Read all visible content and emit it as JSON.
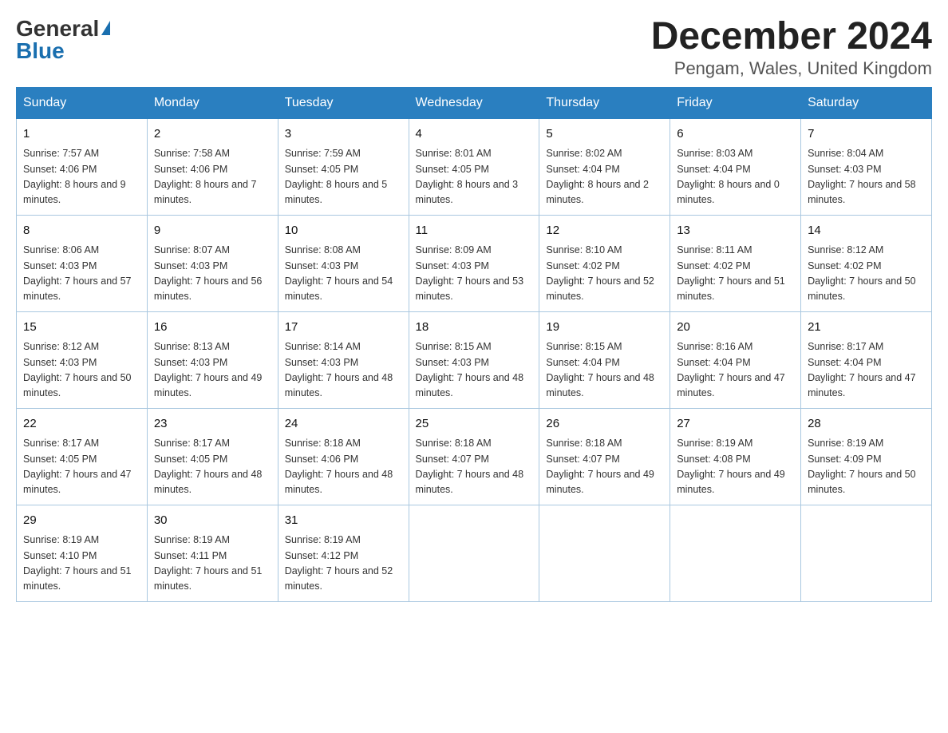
{
  "header": {
    "logo_general": "General",
    "logo_triangle": "▶",
    "logo_blue": "Blue",
    "month_title": "December 2024",
    "location": "Pengam, Wales, United Kingdom"
  },
  "days_of_week": [
    "Sunday",
    "Monday",
    "Tuesday",
    "Wednesday",
    "Thursday",
    "Friday",
    "Saturday"
  ],
  "weeks": [
    [
      {
        "day": "1",
        "sunrise": "7:57 AM",
        "sunset": "4:06 PM",
        "daylight": "8 hours and 9 minutes."
      },
      {
        "day": "2",
        "sunrise": "7:58 AM",
        "sunset": "4:06 PM",
        "daylight": "8 hours and 7 minutes."
      },
      {
        "day": "3",
        "sunrise": "7:59 AM",
        "sunset": "4:05 PM",
        "daylight": "8 hours and 5 minutes."
      },
      {
        "day": "4",
        "sunrise": "8:01 AM",
        "sunset": "4:05 PM",
        "daylight": "8 hours and 3 minutes."
      },
      {
        "day": "5",
        "sunrise": "8:02 AM",
        "sunset": "4:04 PM",
        "daylight": "8 hours and 2 minutes."
      },
      {
        "day": "6",
        "sunrise": "8:03 AM",
        "sunset": "4:04 PM",
        "daylight": "8 hours and 0 minutes."
      },
      {
        "day": "7",
        "sunrise": "8:04 AM",
        "sunset": "4:03 PM",
        "daylight": "7 hours and 58 minutes."
      }
    ],
    [
      {
        "day": "8",
        "sunrise": "8:06 AM",
        "sunset": "4:03 PM",
        "daylight": "7 hours and 57 minutes."
      },
      {
        "day": "9",
        "sunrise": "8:07 AM",
        "sunset": "4:03 PM",
        "daylight": "7 hours and 56 minutes."
      },
      {
        "day": "10",
        "sunrise": "8:08 AM",
        "sunset": "4:03 PM",
        "daylight": "7 hours and 54 minutes."
      },
      {
        "day": "11",
        "sunrise": "8:09 AM",
        "sunset": "4:03 PM",
        "daylight": "7 hours and 53 minutes."
      },
      {
        "day": "12",
        "sunrise": "8:10 AM",
        "sunset": "4:02 PM",
        "daylight": "7 hours and 52 minutes."
      },
      {
        "day": "13",
        "sunrise": "8:11 AM",
        "sunset": "4:02 PM",
        "daylight": "7 hours and 51 minutes."
      },
      {
        "day": "14",
        "sunrise": "8:12 AM",
        "sunset": "4:02 PM",
        "daylight": "7 hours and 50 minutes."
      }
    ],
    [
      {
        "day": "15",
        "sunrise": "8:12 AM",
        "sunset": "4:03 PM",
        "daylight": "7 hours and 50 minutes."
      },
      {
        "day": "16",
        "sunrise": "8:13 AM",
        "sunset": "4:03 PM",
        "daylight": "7 hours and 49 minutes."
      },
      {
        "day": "17",
        "sunrise": "8:14 AM",
        "sunset": "4:03 PM",
        "daylight": "7 hours and 48 minutes."
      },
      {
        "day": "18",
        "sunrise": "8:15 AM",
        "sunset": "4:03 PM",
        "daylight": "7 hours and 48 minutes."
      },
      {
        "day": "19",
        "sunrise": "8:15 AM",
        "sunset": "4:04 PM",
        "daylight": "7 hours and 48 minutes."
      },
      {
        "day": "20",
        "sunrise": "8:16 AM",
        "sunset": "4:04 PM",
        "daylight": "7 hours and 47 minutes."
      },
      {
        "day": "21",
        "sunrise": "8:17 AM",
        "sunset": "4:04 PM",
        "daylight": "7 hours and 47 minutes."
      }
    ],
    [
      {
        "day": "22",
        "sunrise": "8:17 AM",
        "sunset": "4:05 PM",
        "daylight": "7 hours and 47 minutes."
      },
      {
        "day": "23",
        "sunrise": "8:17 AM",
        "sunset": "4:05 PM",
        "daylight": "7 hours and 48 minutes."
      },
      {
        "day": "24",
        "sunrise": "8:18 AM",
        "sunset": "4:06 PM",
        "daylight": "7 hours and 48 minutes."
      },
      {
        "day": "25",
        "sunrise": "8:18 AM",
        "sunset": "4:07 PM",
        "daylight": "7 hours and 48 minutes."
      },
      {
        "day": "26",
        "sunrise": "8:18 AM",
        "sunset": "4:07 PM",
        "daylight": "7 hours and 49 minutes."
      },
      {
        "day": "27",
        "sunrise": "8:19 AM",
        "sunset": "4:08 PM",
        "daylight": "7 hours and 49 minutes."
      },
      {
        "day": "28",
        "sunrise": "8:19 AM",
        "sunset": "4:09 PM",
        "daylight": "7 hours and 50 minutes."
      }
    ],
    [
      {
        "day": "29",
        "sunrise": "8:19 AM",
        "sunset": "4:10 PM",
        "daylight": "7 hours and 51 minutes."
      },
      {
        "day": "30",
        "sunrise": "8:19 AM",
        "sunset": "4:11 PM",
        "daylight": "7 hours and 51 minutes."
      },
      {
        "day": "31",
        "sunrise": "8:19 AM",
        "sunset": "4:12 PM",
        "daylight": "7 hours and 52 minutes."
      },
      null,
      null,
      null,
      null
    ]
  ]
}
